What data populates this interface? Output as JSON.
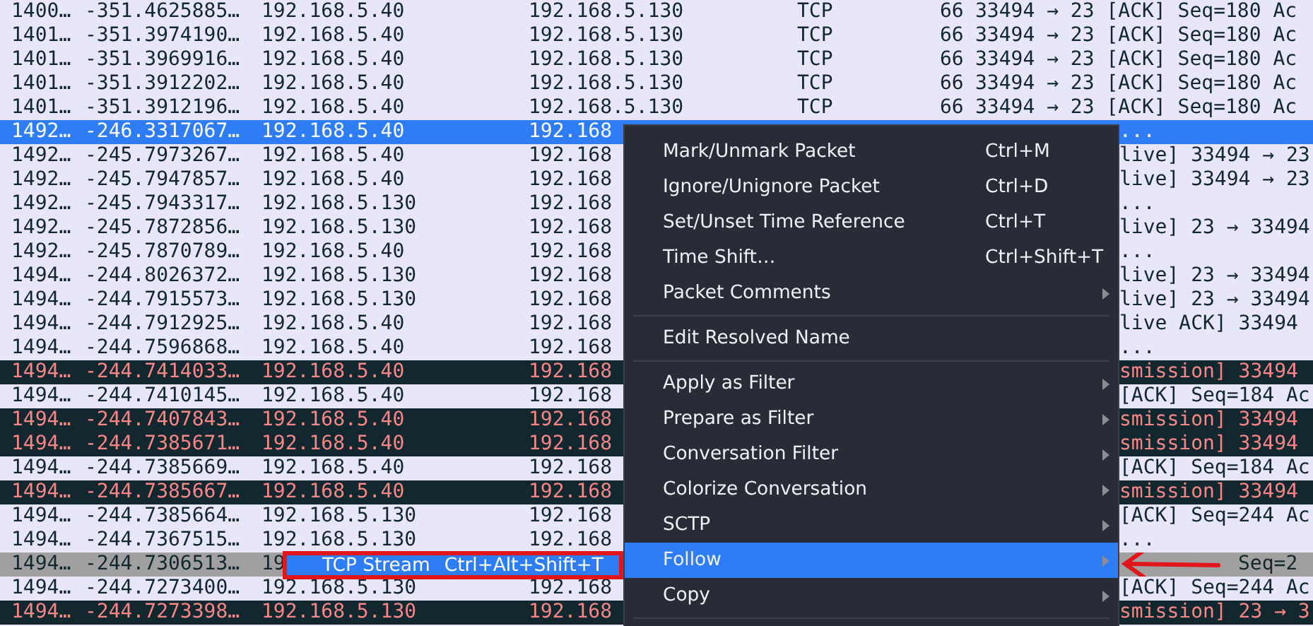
{
  "packet_list": {
    "rows": [
      {
        "kind": "normal",
        "selected": false,
        "no": "1400…",
        "time": "-351.4625885…",
        "source": "192.168.5.40",
        "destination": "192.168.5.130",
        "protocol": "TCP",
        "length": "66",
        "info": "33494 → 23 [ACK] Seq=180 Ac"
      },
      {
        "kind": "normal",
        "selected": false,
        "no": "1401…",
        "time": "-351.3974190…",
        "source": "192.168.5.40",
        "destination": "192.168.5.130",
        "protocol": "TCP",
        "length": "66",
        "info": "33494 → 23 [ACK] Seq=180 Ac"
      },
      {
        "kind": "normal",
        "selected": false,
        "no": "1401…",
        "time": "-351.3969916…",
        "source": "192.168.5.40",
        "destination": "192.168.5.130",
        "protocol": "TCP",
        "length": "66",
        "info": "33494 → 23 [ACK] Seq=180 Ac"
      },
      {
        "kind": "normal",
        "selected": false,
        "no": "1401…",
        "time": "-351.3912202…",
        "source": "192.168.5.40",
        "destination": "192.168.5.130",
        "protocol": "TCP",
        "length": "66",
        "info": "33494 → 23 [ACK] Seq=180 Ac"
      },
      {
        "kind": "normal",
        "selected": false,
        "no": "1401…",
        "time": "-351.3912196…",
        "source": "192.168.5.40",
        "destination": "192.168.5.130",
        "protocol": "TCP",
        "length": "66",
        "info": "33494 → 23 [ACK] Seq=180 Ac"
      },
      {
        "kind": "normal",
        "selected": true,
        "no": "1492…",
        "time": "-246.3317067…",
        "source": "192.168.5.40",
        "destination": "192.168",
        "info": " ..."
      },
      {
        "kind": "normal",
        "selected": false,
        "no": "1492…",
        "time": "-245.7973267…",
        "source": "192.168.5.40",
        "destination": "192.168",
        "info": "live] 33494 → 23"
      },
      {
        "kind": "normal",
        "selected": false,
        "no": "1492…",
        "time": "-245.7947857…",
        "source": "192.168.5.40",
        "destination": "192.168",
        "info": "live] 33494 → 23"
      },
      {
        "kind": "normal",
        "selected": false,
        "no": "1492…",
        "time": "-245.7943317…",
        "source": "192.168.5.130",
        "destination": "192.168",
        "info": " ..."
      },
      {
        "kind": "normal",
        "selected": false,
        "no": "1492…",
        "time": "-245.7872856…",
        "source": "192.168.5.130",
        "destination": "192.168",
        "info": "live] 23 → 33494"
      },
      {
        "kind": "normal",
        "selected": false,
        "no": "1492…",
        "time": "-245.7870789…",
        "source": "192.168.5.40",
        "destination": "192.168",
        "info": " ..."
      },
      {
        "kind": "normal",
        "selected": false,
        "no": "1494…",
        "time": "-244.8026372…",
        "source": "192.168.5.130",
        "destination": "192.168",
        "info": "live] 23 → 33494"
      },
      {
        "kind": "normal",
        "selected": false,
        "no": "1494…",
        "time": "-244.7915573…",
        "source": "192.168.5.130",
        "destination": "192.168",
        "info": "live] 23 → 33494"
      },
      {
        "kind": "normal",
        "selected": false,
        "no": "1494…",
        "time": "-244.7912925…",
        "source": "192.168.5.40",
        "destination": "192.168",
        "info": "live ACK] 33494"
      },
      {
        "kind": "normal",
        "selected": false,
        "no": "1494…",
        "time": "-244.7596868…",
        "source": "192.168.5.40",
        "destination": "192.168",
        "info": " ..."
      },
      {
        "kind": "bad",
        "selected": false,
        "no": "1494…",
        "time": "-244.7414033…",
        "source": "192.168.5.40",
        "destination": "192.168",
        "info": "smission] 33494"
      },
      {
        "kind": "normal",
        "selected": false,
        "no": "1494…",
        "time": "-244.7410145…",
        "source": "192.168.5.40",
        "destination": "192.168",
        "info": "[ACK] Seq=184 Ac"
      },
      {
        "kind": "bad",
        "selected": false,
        "no": "1494…",
        "time": "-244.7407843…",
        "source": "192.168.5.40",
        "destination": "192.168",
        "info": "smission] 33494"
      },
      {
        "kind": "bad",
        "selected": false,
        "no": "1494…",
        "time": "-244.7385671…",
        "source": "192.168.5.40",
        "destination": "192.168",
        "info": "smission] 33494"
      },
      {
        "kind": "normal",
        "selected": false,
        "no": "1494…",
        "time": "-244.7385669…",
        "source": "192.168.5.40",
        "destination": "192.168",
        "info": "[ACK] Seq=184 Ac"
      },
      {
        "kind": "bad",
        "selected": false,
        "no": "1494…",
        "time": "-244.7385667…",
        "source": "192.168.5.40",
        "destination": "192.168",
        "info": "smission] 33494"
      },
      {
        "kind": "normal",
        "selected": false,
        "no": "1494…",
        "time": "-244.7385664…",
        "source": "192.168.5.130",
        "destination": "192.168",
        "info": "[ACK] Seq=244 Ac"
      },
      {
        "kind": "normal",
        "selected": false,
        "no": "1494…",
        "time": "-244.7367515…",
        "source": "192.168.5.130",
        "destination": "192.168",
        "info": " ..."
      },
      {
        "kind": "marked",
        "selected": false,
        "no": "1494…",
        "time": "-244.7306513…",
        "source": "19",
        "info": "Seq=2",
        "arrow": true
      },
      {
        "kind": "normal",
        "selected": false,
        "no": "1494…",
        "time": "-244.7273400…",
        "source": "192.168.5.130",
        "destination": "192.168",
        "info": "[ACK] Seq=244 Ac"
      },
      {
        "kind": "bad",
        "selected": false,
        "no": "1494…",
        "time": "-244.7273398…",
        "source": "192.168.5.130",
        "destination": "192.168",
        "info": "smission] 23 → 3"
      }
    ]
  },
  "context_menu": {
    "items": [
      {
        "kind": "item",
        "label": "Mark/Unmark Packet",
        "shortcut": "Ctrl+M",
        "submenu": false,
        "selected": false
      },
      {
        "kind": "item",
        "label": "Ignore/Unignore Packet",
        "shortcut": "Ctrl+D",
        "submenu": false,
        "selected": false
      },
      {
        "kind": "item",
        "label": "Set/Unset Time Reference",
        "shortcut": "Ctrl+T",
        "submenu": false,
        "selected": false
      },
      {
        "kind": "item",
        "label": "Time Shift…",
        "shortcut": "Ctrl+Shift+T",
        "submenu": false,
        "selected": false
      },
      {
        "kind": "item",
        "label": "Packet Comments",
        "submenu": true,
        "selected": false
      },
      {
        "kind": "separator"
      },
      {
        "kind": "item",
        "label": "Edit Resolved Name",
        "submenu": false,
        "selected": false
      },
      {
        "kind": "separator"
      },
      {
        "kind": "item",
        "label": "Apply as Filter",
        "submenu": true,
        "selected": false
      },
      {
        "kind": "item",
        "label": "Prepare as Filter",
        "submenu": true,
        "selected": false
      },
      {
        "kind": "item",
        "label": "Conversation Filter",
        "submenu": true,
        "selected": false
      },
      {
        "kind": "item",
        "label": "Colorize Conversation",
        "submenu": true,
        "selected": false
      },
      {
        "kind": "item",
        "label": "SCTP",
        "submenu": true,
        "selected": false
      },
      {
        "kind": "item",
        "label": "Follow",
        "submenu": true,
        "selected": true
      },
      {
        "kind": "item",
        "label": "Copy",
        "submenu": true,
        "selected": false
      },
      {
        "kind": "separator"
      }
    ]
  },
  "submenu": {
    "items": [
      {
        "label": "TCP Stream",
        "shortcut": "Ctrl+Alt+Shift+T",
        "selected": true,
        "outlined": true
      }
    ]
  }
}
